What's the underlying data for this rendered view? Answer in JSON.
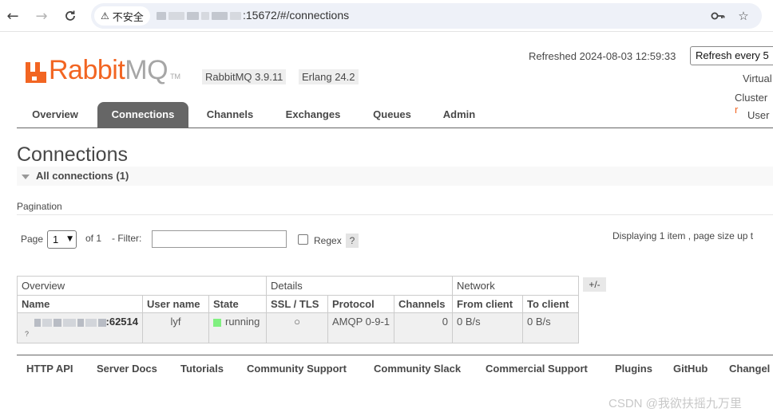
{
  "browser": {
    "security_label": "不安全",
    "url_suffix": ":15672/#/connections"
  },
  "header": {
    "logo_brand": "Rabbit",
    "logo_mq": "MQ",
    "logo_tm": "TM",
    "rabbitmq_version": "RabbitMQ 3.9.11",
    "erlang_version": "Erlang 24.2",
    "refreshed": "Refreshed 2024-08-03 12:59:33",
    "refresh_select": "Refresh every 5",
    "virtual_label": "Virtual",
    "cluster_label": "Cluster",
    "cluster_dot": "r",
    "user_label": "User"
  },
  "tabs": [
    {
      "label": "Overview"
    },
    {
      "label": "Connections"
    },
    {
      "label": "Channels"
    },
    {
      "label": "Exchanges"
    },
    {
      "label": "Queues"
    },
    {
      "label": "Admin"
    }
  ],
  "main": {
    "title": "Connections",
    "section": "All connections (1)",
    "pagination_label": "Pagination",
    "page_label": "Page",
    "page_value": "1",
    "of_label": "of 1",
    "filter_label": "- Filter:",
    "regex_label": "Regex",
    "help": "?",
    "displaying": "Displaying 1 item , page size up t"
  },
  "table": {
    "groups": [
      "Overview",
      "Details",
      "Network"
    ],
    "headers": [
      "Name",
      "User name",
      "State",
      "SSL / TLS",
      "Protocol",
      "Channels",
      "From client",
      "To client"
    ],
    "row": {
      "name_port": ":62514",
      "name_hint": "?",
      "user": "lyf",
      "state": "running",
      "ssl": "○",
      "protocol": "AMQP 0-9-1",
      "channels": "0",
      "from_client": "0 B/s",
      "to_client": "0 B/s"
    },
    "columns_toggle": "+/-"
  },
  "footer": {
    "links": [
      "HTTP API",
      "Server Docs",
      "Tutorials",
      "Community Support",
      "Community Slack",
      "Commercial Support",
      "Plugins",
      "GitHub",
      "Changel"
    ]
  },
  "watermark": "CSDN @我欲扶摇九万里"
}
